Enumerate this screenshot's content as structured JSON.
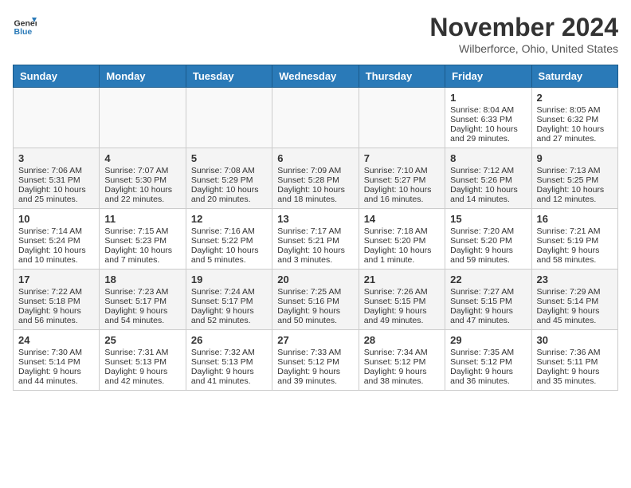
{
  "header": {
    "logo_line1": "General",
    "logo_line2": "Blue",
    "month_year": "November 2024",
    "location": "Wilberforce, Ohio, United States"
  },
  "days_of_week": [
    "Sunday",
    "Monday",
    "Tuesday",
    "Wednesday",
    "Thursday",
    "Friday",
    "Saturday"
  ],
  "weeks": [
    [
      {
        "day": "",
        "info": ""
      },
      {
        "day": "",
        "info": ""
      },
      {
        "day": "",
        "info": ""
      },
      {
        "day": "",
        "info": ""
      },
      {
        "day": "",
        "info": ""
      },
      {
        "day": "1",
        "info": "Sunrise: 8:04 AM\nSunset: 6:33 PM\nDaylight: 10 hours and 29 minutes."
      },
      {
        "day": "2",
        "info": "Sunrise: 8:05 AM\nSunset: 6:32 PM\nDaylight: 10 hours and 27 minutes."
      }
    ],
    [
      {
        "day": "3",
        "info": "Sunrise: 7:06 AM\nSunset: 5:31 PM\nDaylight: 10 hours and 25 minutes."
      },
      {
        "day": "4",
        "info": "Sunrise: 7:07 AM\nSunset: 5:30 PM\nDaylight: 10 hours and 22 minutes."
      },
      {
        "day": "5",
        "info": "Sunrise: 7:08 AM\nSunset: 5:29 PM\nDaylight: 10 hours and 20 minutes."
      },
      {
        "day": "6",
        "info": "Sunrise: 7:09 AM\nSunset: 5:28 PM\nDaylight: 10 hours and 18 minutes."
      },
      {
        "day": "7",
        "info": "Sunrise: 7:10 AM\nSunset: 5:27 PM\nDaylight: 10 hours and 16 minutes."
      },
      {
        "day": "8",
        "info": "Sunrise: 7:12 AM\nSunset: 5:26 PM\nDaylight: 10 hours and 14 minutes."
      },
      {
        "day": "9",
        "info": "Sunrise: 7:13 AM\nSunset: 5:25 PM\nDaylight: 10 hours and 12 minutes."
      }
    ],
    [
      {
        "day": "10",
        "info": "Sunrise: 7:14 AM\nSunset: 5:24 PM\nDaylight: 10 hours and 10 minutes."
      },
      {
        "day": "11",
        "info": "Sunrise: 7:15 AM\nSunset: 5:23 PM\nDaylight: 10 hours and 7 minutes."
      },
      {
        "day": "12",
        "info": "Sunrise: 7:16 AM\nSunset: 5:22 PM\nDaylight: 10 hours and 5 minutes."
      },
      {
        "day": "13",
        "info": "Sunrise: 7:17 AM\nSunset: 5:21 PM\nDaylight: 10 hours and 3 minutes."
      },
      {
        "day": "14",
        "info": "Sunrise: 7:18 AM\nSunset: 5:20 PM\nDaylight: 10 hours and 1 minute."
      },
      {
        "day": "15",
        "info": "Sunrise: 7:20 AM\nSunset: 5:20 PM\nDaylight: 9 hours and 59 minutes."
      },
      {
        "day": "16",
        "info": "Sunrise: 7:21 AM\nSunset: 5:19 PM\nDaylight: 9 hours and 58 minutes."
      }
    ],
    [
      {
        "day": "17",
        "info": "Sunrise: 7:22 AM\nSunset: 5:18 PM\nDaylight: 9 hours and 56 minutes."
      },
      {
        "day": "18",
        "info": "Sunrise: 7:23 AM\nSunset: 5:17 PM\nDaylight: 9 hours and 54 minutes."
      },
      {
        "day": "19",
        "info": "Sunrise: 7:24 AM\nSunset: 5:17 PM\nDaylight: 9 hours and 52 minutes."
      },
      {
        "day": "20",
        "info": "Sunrise: 7:25 AM\nSunset: 5:16 PM\nDaylight: 9 hours and 50 minutes."
      },
      {
        "day": "21",
        "info": "Sunrise: 7:26 AM\nSunset: 5:15 PM\nDaylight: 9 hours and 49 minutes."
      },
      {
        "day": "22",
        "info": "Sunrise: 7:27 AM\nSunset: 5:15 PM\nDaylight: 9 hours and 47 minutes."
      },
      {
        "day": "23",
        "info": "Sunrise: 7:29 AM\nSunset: 5:14 PM\nDaylight: 9 hours and 45 minutes."
      }
    ],
    [
      {
        "day": "24",
        "info": "Sunrise: 7:30 AM\nSunset: 5:14 PM\nDaylight: 9 hours and 44 minutes."
      },
      {
        "day": "25",
        "info": "Sunrise: 7:31 AM\nSunset: 5:13 PM\nDaylight: 9 hours and 42 minutes."
      },
      {
        "day": "26",
        "info": "Sunrise: 7:32 AM\nSunset: 5:13 PM\nDaylight: 9 hours and 41 minutes."
      },
      {
        "day": "27",
        "info": "Sunrise: 7:33 AM\nSunset: 5:12 PM\nDaylight: 9 hours and 39 minutes."
      },
      {
        "day": "28",
        "info": "Sunrise: 7:34 AM\nSunset: 5:12 PM\nDaylight: 9 hours and 38 minutes."
      },
      {
        "day": "29",
        "info": "Sunrise: 7:35 AM\nSunset: 5:12 PM\nDaylight: 9 hours and 36 minutes."
      },
      {
        "day": "30",
        "info": "Sunrise: 7:36 AM\nSunset: 5:11 PM\nDaylight: 9 hours and 35 minutes."
      }
    ]
  ]
}
